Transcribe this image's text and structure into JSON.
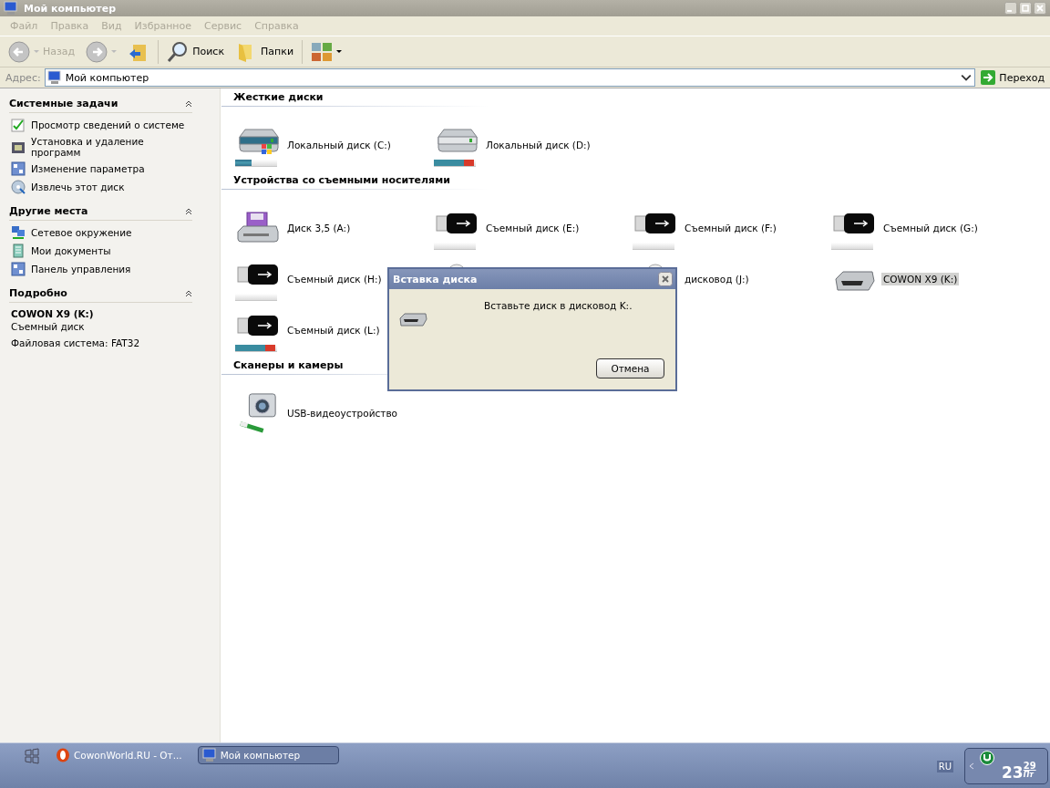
{
  "window": {
    "title": "Мой компьютер"
  },
  "menu": [
    {
      "label": "Файл"
    },
    {
      "label": "Правка"
    },
    {
      "label": "Вид"
    },
    {
      "label": "Избранное"
    },
    {
      "label": "Сервис"
    },
    {
      "label": "Справка"
    }
  ],
  "toolbar": [
    {
      "kind": "back",
      "label": "Назад",
      "disabled": true
    },
    {
      "kind": "forward",
      "disabled": true
    },
    {
      "kind": "up"
    },
    {
      "kind": "search",
      "label": "Поиск"
    },
    {
      "kind": "folders",
      "label": "Папки"
    },
    {
      "kind": "views"
    }
  ],
  "address": {
    "label": "Адрес:",
    "value": "Мой компьютер",
    "go": "Переход"
  },
  "sidebar": {
    "panels": [
      {
        "title": "Системные задачи",
        "expanded": true,
        "items": [
          {
            "kind": "check",
            "label": "Просмотр сведений о системе"
          },
          {
            "kind": "programs",
            "label": "Установка и удаление программ"
          },
          {
            "kind": "panel",
            "label": "Изменение параметра"
          },
          {
            "kind": "eject",
            "label": "Извлечь этот диск"
          }
        ]
      },
      {
        "title": "Другие места",
        "expanded": true,
        "items": [
          {
            "kind": "network",
            "label": "Сетевое окружение"
          },
          {
            "kind": "documents",
            "label": "Мои документы"
          },
          {
            "kind": "panel",
            "label": "Панель управления"
          }
        ]
      }
    ],
    "details": {
      "title": "Подробно",
      "expanded": true,
      "name": "COWON X9 (K:)",
      "type": "Съемный диск",
      "filesystem": "Файловая система: FAT32"
    }
  },
  "sections": [
    {
      "title": "Жесткие диски",
      "items": [
        {
          "kind": "hdd_system",
          "name": "Локальный диск (C:)",
          "level": 0.4,
          "selected": false
        },
        {
          "kind": "hdd",
          "name": "Локальный диск (D:)",
          "level": 0.95,
          "selected": false
        }
      ]
    },
    {
      "title": "Устройства со съемными носителями",
      "items": [
        {
          "kind": "floppy",
          "name": "Диск 3,5 (A:)",
          "selected": false
        },
        {
          "kind": "usb",
          "name": "Съемный диск (E:)",
          "level": 0,
          "selected": false
        },
        {
          "kind": "usb",
          "name": "Съемный диск (F:)",
          "level": 0,
          "selected": false
        },
        {
          "kind": "usb",
          "name": "Съемный диск (G:)",
          "level": 0,
          "selected": false
        },
        {
          "kind": "usb",
          "name": "Съемный диск (H:)",
          "level": 0,
          "selected": false
        },
        {
          "kind": "optical"
        },
        {
          "kind": "optical",
          "name": "дисковод (J:)",
          "selected": false
        },
        {
          "kind": "player",
          "name": "COWON X9 (K:)",
          "selected": true
        },
        {
          "kind": "usb",
          "name": "Съемный диск (L:)",
          "level": 0.95,
          "selected": false
        }
      ]
    },
    {
      "title": "Сканеры и камеры",
      "items": [
        {
          "kind": "camera",
          "name": "USB-видеоустройство",
          "selected": false
        }
      ]
    }
  ],
  "dialog": {
    "title": "Вставка диска",
    "message": "Вставьте диск в дисковод K:.",
    "button": "Отмена"
  },
  "taskbar": {
    "tasks": [
      {
        "kind": "opera",
        "label": "CowonWorld.RU - От...",
        "selected": false
      },
      {
        "kind": "computer",
        "label": "Мой компьютер",
        "selected": true
      }
    ],
    "language": "RU",
    "clock": {
      "hour": "23",
      "minute": "29",
      "day": "Пт"
    }
  }
}
